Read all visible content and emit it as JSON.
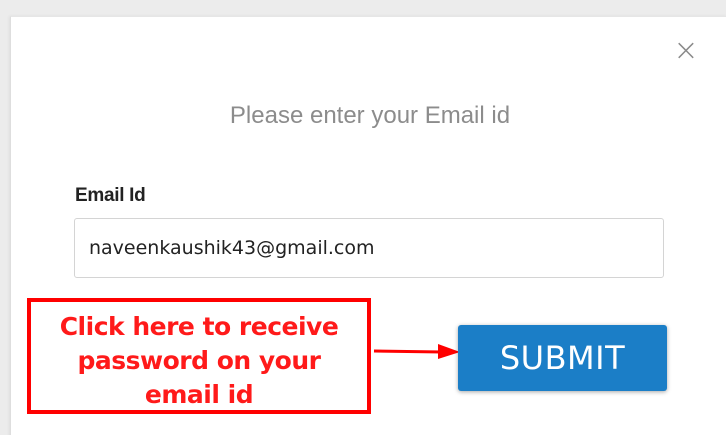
{
  "modal": {
    "close_icon": "×",
    "heading": "Please enter your Email id",
    "email_label": "Email Id",
    "email_value": "naveenkaushik43@gmail.com",
    "submit_label": "SUBMIT"
  },
  "annotation": {
    "lines": [
      "Click here to receive",
      "password on your",
      "email id"
    ]
  },
  "colors": {
    "annotation_red": "#ff0000",
    "button_blue": "#1b7ec7"
  },
  "icons": {
    "close": "close-icon",
    "arrow": "arrow-right-icon"
  }
}
